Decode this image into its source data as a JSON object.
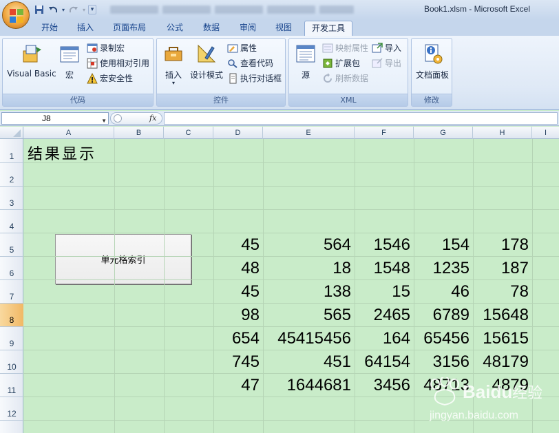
{
  "window": {
    "title": "Book1.xlsm - Microsoft Excel"
  },
  "quick_access": {
    "items": [
      "save-icon",
      "undo-icon",
      "redo-icon",
      "customize-icon"
    ]
  },
  "ribbon_tabs": [
    {
      "label": "开始",
      "active": false
    },
    {
      "label": "插入",
      "active": false
    },
    {
      "label": "页面布局",
      "active": false
    },
    {
      "label": "公式",
      "active": false
    },
    {
      "label": "数据",
      "active": false
    },
    {
      "label": "审阅",
      "active": false
    },
    {
      "label": "视图",
      "active": false
    },
    {
      "label": "开发工具",
      "active": true
    }
  ],
  "ribbon": {
    "code": {
      "label": "代码",
      "visual_basic": "Visual Basic",
      "macros": "宏",
      "record_macro": "录制宏",
      "relative_ref": "使用相对引用",
      "macro_security": "宏安全性"
    },
    "controls": {
      "label": "控件",
      "insert": "插入",
      "design_mode": "设计模式",
      "properties": "属性",
      "view_code": "查看代码",
      "run_dialog": "执行对话框"
    },
    "xml": {
      "label": "XML",
      "source": "源",
      "map_properties": "映射属性",
      "expansion_packs": "扩展包",
      "refresh_data": "刷新数据",
      "import": "导入",
      "export": "导出"
    },
    "modify": {
      "label": "修改",
      "document_panel": "文档面板"
    }
  },
  "formula_bar": {
    "name_box": "J8",
    "fx": "fx",
    "content": ""
  },
  "columns": [
    "A",
    "B",
    "C",
    "D",
    "E",
    "F",
    "G",
    "H",
    "I"
  ],
  "rows": [
    "1",
    "2",
    "3",
    "4",
    "5",
    "6",
    "7",
    "8",
    "9",
    "10",
    "11",
    "12"
  ],
  "selected_row": "8",
  "sheet": {
    "title": "结果显示",
    "button_label": "单元格索引",
    "data": [
      [
        "45",
        "564",
        "1546",
        "154",
        "178"
      ],
      [
        "48",
        "18",
        "1548",
        "1235",
        "187"
      ],
      [
        "45",
        "138",
        "15",
        "46",
        "78"
      ],
      [
        "98",
        "565",
        "2465",
        "6789",
        "15648"
      ],
      [
        "654",
        "45415456",
        "164",
        "65456",
        "15615"
      ],
      [
        "745",
        "451",
        "64154",
        "3156",
        "48179"
      ],
      [
        "47",
        "1644681",
        "3456",
        "48713",
        "4879"
      ]
    ]
  },
  "watermark": {
    "brand": "Baidu",
    "brand_cn": "经验",
    "url": "jingyan.baidu.com"
  },
  "colors": {
    "sheet_bg": "#c9ecc9",
    "ribbon_bg": "#dfe9f6",
    "title_bg": "#c5d6ec",
    "selected_row": "#f1b865"
  }
}
